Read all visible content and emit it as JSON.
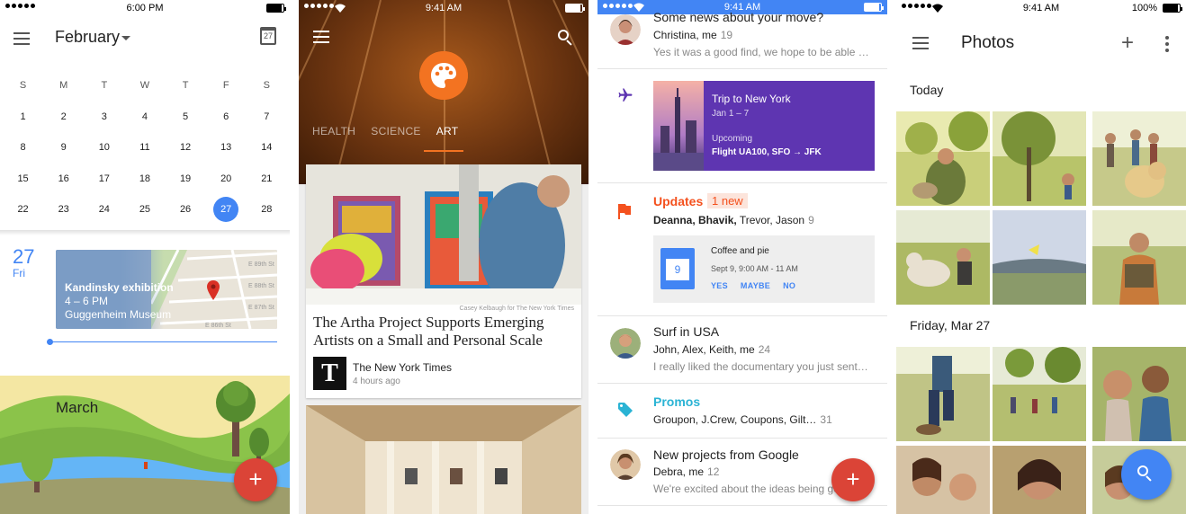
{
  "calendar": {
    "status_time": "6:00 PM",
    "month": "February",
    "today_icon_day": "27",
    "weekdays": [
      "S",
      "M",
      "T",
      "W",
      "T",
      "F",
      "S"
    ],
    "weeks": [
      [
        "1",
        "2",
        "3",
        "4",
        "5",
        "6",
        "7"
      ],
      [
        "8",
        "9",
        "10",
        "11",
        "12",
        "13",
        "14"
      ],
      [
        "15",
        "16",
        "17",
        "18",
        "19",
        "20",
        "21"
      ],
      [
        "22",
        "23",
        "24",
        "25",
        "26",
        "27",
        "28"
      ]
    ],
    "selected_day": "27",
    "event_day": "27",
    "event_weekday": "Fri",
    "event_title": "Kandinsky exhibition",
    "event_time": "4 – 6 PM",
    "event_place": "Guggenheim Museum",
    "map_streets": [
      "E 89th St",
      "E 88th St",
      "E 87th St",
      "E 86th St"
    ],
    "next_month": "March",
    "fab_label": "+",
    "accent": "#4285f4",
    "fab_color": "#db4437"
  },
  "news": {
    "status_time": "9:41 AM",
    "tabs": [
      "HEALTH",
      "SCIENCE",
      "ART"
    ],
    "active_tab": "ART",
    "photo_credit": "Casey Kelbaugh for The New York Times",
    "article_title": "The Artha Project Supports Emerging Artists on a Small and Personal Scale",
    "source": "The New York Times",
    "source_logo": "T",
    "time_ago": "4 hours ago",
    "accent": "#f37321"
  },
  "inbox": {
    "status_time": "9:41 AM",
    "items": [
      {
        "title": "Some news about your move?",
        "people": "Christina, me",
        "count": "19",
        "snippet": "Yes it was a good find, we hope to be able …"
      },
      {
        "title": "Surf in USA",
        "people": "John, Alex, Keith, me",
        "count": "24",
        "snippet": "I really liked the documentary you just sent…"
      },
      {
        "title": "New projects from Google",
        "people": "Debra, me",
        "count": "12",
        "snippet": "We're excited about the ideas being ge"
      }
    ],
    "trip": {
      "title": "Trip to New York",
      "dates": "Jan 1 – 7",
      "status": "Upcoming",
      "flight": "Flight UA100,  SFO → JFK"
    },
    "updates": {
      "label": "Updates",
      "badge": "1 new",
      "people_bold": "Deanna, Bhavik,",
      "people_rest": "Trevor, Jason",
      "count": "9",
      "event_title": "Coffee and pie",
      "event_when": "Sept 9, 9:00 AM - 11 AM",
      "event_day": "9",
      "actions": [
        "YES",
        "MAYBE",
        "NO"
      ]
    },
    "promos": {
      "label": "Promos",
      "senders": "Groupon, J.Crew, Coupons, Gilt…",
      "count": "31"
    },
    "fab_label": "+",
    "colors": {
      "status_bar": "#4285f4",
      "updates": "#f4511e",
      "promos": "#2ab3d4",
      "trip": "#5e35b1",
      "fab": "#db4437"
    }
  },
  "photos": {
    "status_time": "9:41 AM",
    "battery_pct": "100%",
    "title": "Photos",
    "sections": [
      "Today",
      "Friday, Mar 27"
    ],
    "fab_icon": "search-icon",
    "fab_color": "#4285f4"
  }
}
